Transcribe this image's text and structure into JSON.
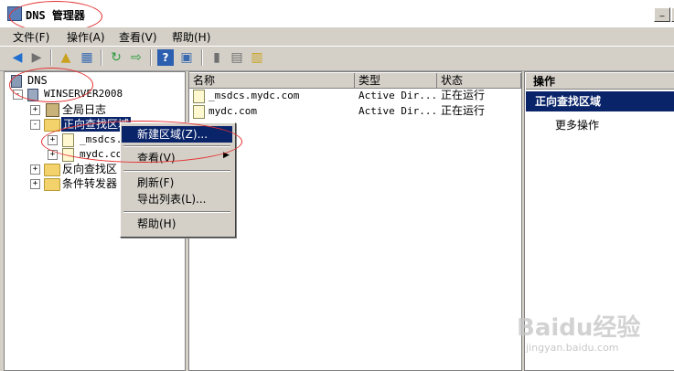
{
  "window": {
    "title": "DNS 管理器"
  },
  "menubar": [
    "文件(F)",
    "操作(A)",
    "查看(V)",
    "帮助(H)"
  ],
  "toolbar": {
    "icons": [
      "back-arrow-icon",
      "forward-arrow-icon",
      "up-folder-icon",
      "show-hide-tree-icon",
      "refresh-icon",
      "export-icon",
      "help-icon",
      "console-icon",
      "server-icon",
      "list-icon",
      "notes-icon"
    ]
  },
  "tree": {
    "root": "DNS",
    "server": "WINSERVER2008",
    "nodes": [
      "全局日志",
      "正向查找区域",
      "_msdcs.",
      "mydc.co",
      "反向查找区",
      "条件转发器"
    ]
  },
  "list": {
    "columns": [
      "名称",
      "类型",
      "状态"
    ],
    "rows": [
      {
        "name": "_msdcs.mydc.com",
        "type": "Active Dir...",
        "status": "正在运行"
      },
      {
        "name": "mydc.com",
        "type": "Active Dir...",
        "status": "正在运行"
      }
    ]
  },
  "actions": {
    "header": "操作",
    "section": "正向查找区域",
    "more": "更多操作"
  },
  "context_menu": {
    "items": [
      "新建区域(Z)...",
      "查看(V)",
      "刷新(F)",
      "导出列表(L)...",
      "帮助(H)"
    ]
  },
  "watermark": {
    "brand": "Baidu经验",
    "url": "jingyan.baidu.com"
  }
}
